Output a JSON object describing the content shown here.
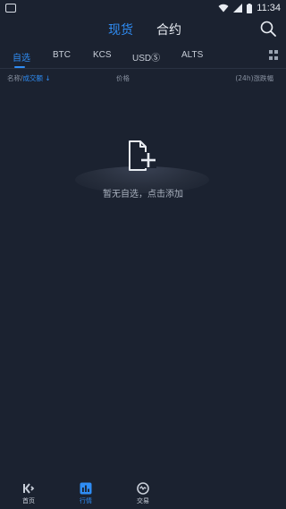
{
  "status_bar": {
    "time": "11:34"
  },
  "top_tabs": {
    "spot": "现货",
    "contract": "合约"
  },
  "market_tabs": [
    {
      "label": "自选",
      "active": true
    },
    {
      "label": "BTC",
      "active": false
    },
    {
      "label": "KCS",
      "active": false
    },
    {
      "label": "USDⓈ",
      "active": false
    },
    {
      "label": "ALTS",
      "active": false
    }
  ],
  "columns": {
    "name_prefix": "名称/",
    "name_sort": "成交额",
    "sort_arrow": "↓",
    "price": "价格",
    "change": "(24h)涨跌幅"
  },
  "empty_state": {
    "message": "暂无自选，点击添加"
  },
  "bottom_nav": [
    {
      "label": "首页",
      "icon": "kucoin-logo-icon",
      "active": false
    },
    {
      "label": "行情",
      "icon": "bar-chart-icon",
      "active": true
    },
    {
      "label": "交易",
      "icon": "exchange-icon",
      "active": false
    }
  ],
  "colors": {
    "accent": "#2f8df5",
    "background": "#1b2230"
  }
}
